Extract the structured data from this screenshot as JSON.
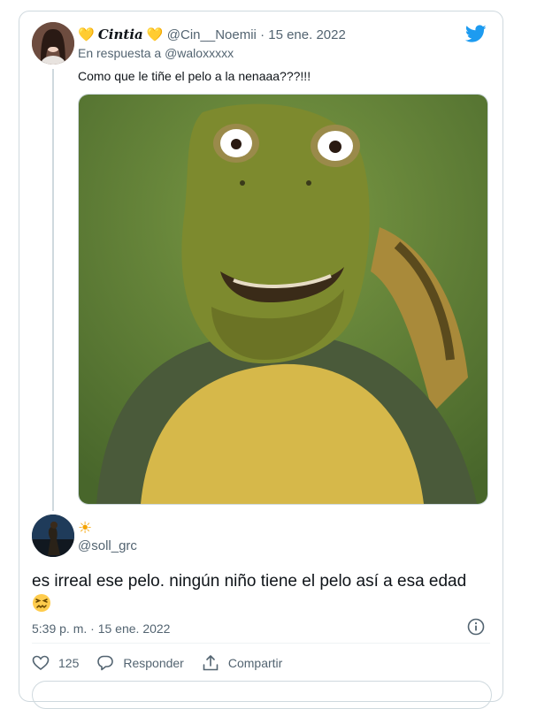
{
  "reply_tweet": {
    "display_name": "𝑪𝒊𝒏𝒕𝒊𝒂",
    "name_emoji_left": "💛",
    "name_emoji_right": "💛",
    "handle": "@Cin__Noemii",
    "separator": "·",
    "date": "15 ene. 2022",
    "reply_prefix": "En respuesta a",
    "reply_to": "@waloxxxxx",
    "text": "Como que le tiñe el pelo a la nenaaa???!!!"
  },
  "main_tweet": {
    "name_emoji": "☀",
    "handle": "@soll_grc",
    "text": "es irreal ese pelo. ningún niño tiene el pelo así a esa edad",
    "time": "5:39 p. m.",
    "separator": "·",
    "date": "15 ene. 2022",
    "likes": "125",
    "reply_label": "Responder",
    "share_label": "Compartir"
  },
  "colors": {
    "brand": "#1d9bf0",
    "muted": "#536471",
    "border": "#cfd9de"
  },
  "icons": [
    "twitter-bird-icon",
    "heart-icon",
    "reply-icon",
    "share-icon",
    "info-icon",
    "sun-emoji",
    "confounded-face-emoji"
  ]
}
